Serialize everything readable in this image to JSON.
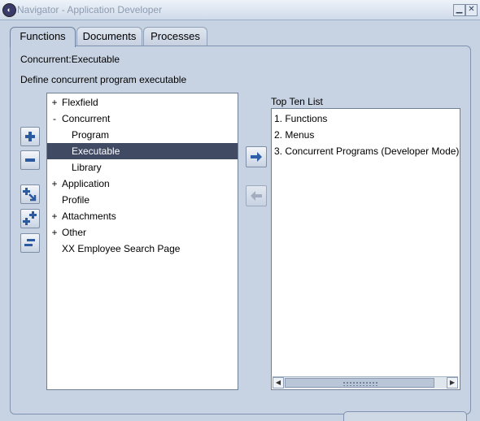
{
  "window": {
    "title": "Navigator - Application Developer",
    "minimize_glyph": "▁",
    "close_glyph": "✕"
  },
  "tabs": [
    {
      "label": "Functions",
      "active": true
    },
    {
      "label": "Documents",
      "active": false
    },
    {
      "label": "Processes",
      "active": false
    }
  ],
  "function": {
    "name": "Concurrent:Executable",
    "description": "Define concurrent program executable"
  },
  "tree": {
    "items": [
      {
        "expander": "+",
        "label": "Flexfield",
        "level": 0,
        "selected": false
      },
      {
        "expander": "-",
        "label": "Concurrent",
        "level": 0,
        "selected": false
      },
      {
        "expander": "",
        "label": "Program",
        "level": 1,
        "selected": false
      },
      {
        "expander": "",
        "label": "Executable",
        "level": 1,
        "selected": true
      },
      {
        "expander": "",
        "label": "Library",
        "level": 1,
        "selected": false
      },
      {
        "expander": "+",
        "label": "Application",
        "level": 0,
        "selected": false
      },
      {
        "expander": "",
        "label": "Profile",
        "level": 0,
        "selected": false
      },
      {
        "expander": "+",
        "label": "Attachments",
        "level": 0,
        "selected": false
      },
      {
        "expander": "+",
        "label": "Other",
        "level": 0,
        "selected": false
      },
      {
        "expander": "",
        "label": "XX Employee Search Page",
        "level": 0,
        "selected": false
      }
    ]
  },
  "side_buttons": {
    "expand": "expand-icon",
    "collapse": "collapse-icon",
    "expand_branch": "expand-branch-icon",
    "expand_all": "expand-all-icon",
    "collapse_all": "collapse-all-icon"
  },
  "top_ten": {
    "label": "Top Ten List",
    "items": [
      "1. Functions",
      "2. Menus",
      "3. Concurrent Programs (Developer Mode)"
    ]
  },
  "colors": {
    "selection": "#404a63",
    "arrow_blue": "#2f5fa8",
    "background": "#c7d3e2"
  }
}
